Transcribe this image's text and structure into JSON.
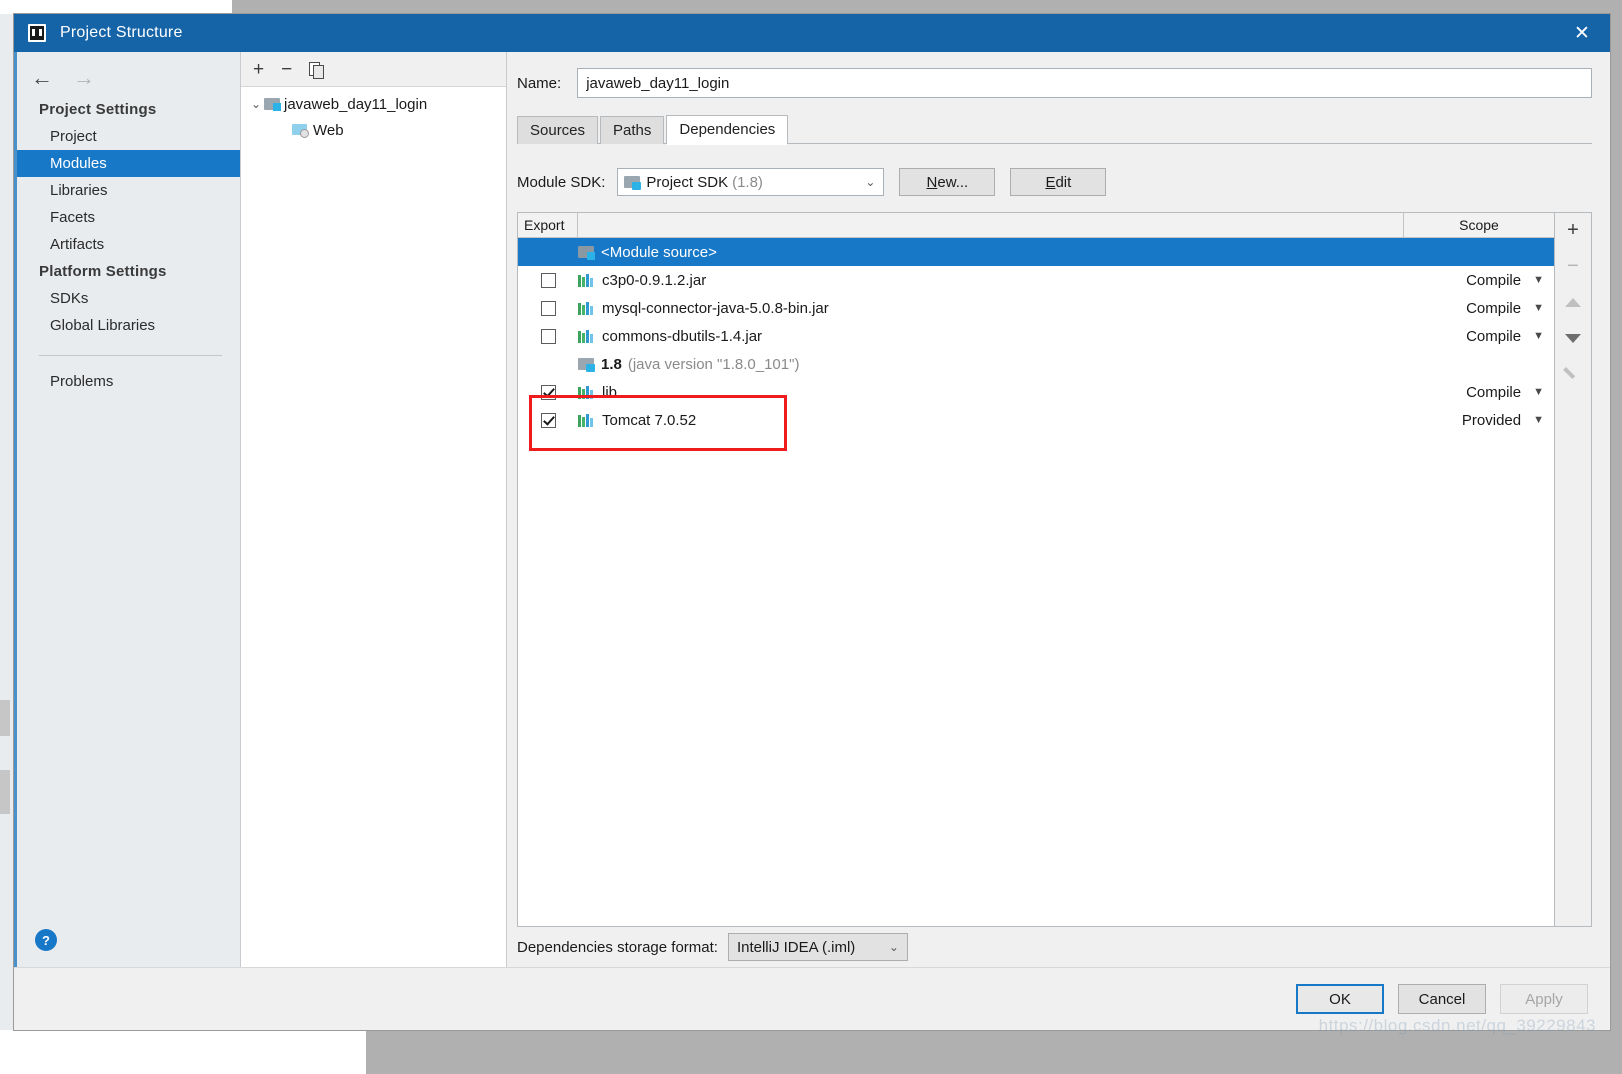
{
  "window": {
    "title": "Project Structure",
    "close_label": "✕",
    "app_icon": "intellij-idea-icon"
  },
  "sidebar": {
    "back_arrow": "←",
    "forward_arrow": "→",
    "groups": [
      {
        "label": "Project Settings",
        "items": [
          {
            "label": "Project",
            "selected": false
          },
          {
            "label": "Modules",
            "selected": true
          },
          {
            "label": "Libraries",
            "selected": false
          },
          {
            "label": "Facets",
            "selected": false
          },
          {
            "label": "Artifacts",
            "selected": false
          }
        ]
      },
      {
        "label": "Platform Settings",
        "items": [
          {
            "label": "SDKs",
            "selected": false
          },
          {
            "label": "Global Libraries",
            "selected": false
          }
        ]
      }
    ],
    "problems_label": "Problems",
    "help_label": "?"
  },
  "tree": {
    "toolbar": {
      "add": "+",
      "remove": "−",
      "copy": "copy-icon"
    },
    "nodes": [
      {
        "label": "javaweb_day11_login",
        "icon": "module-folder-icon",
        "expanded": true,
        "chevron": "⌄"
      },
      {
        "label": "Web",
        "icon": "web-facet-icon",
        "expanded": false
      }
    ]
  },
  "module": {
    "name_label": "Name:",
    "name_value": "javaweb_day11_login",
    "tabs": [
      {
        "label": "Sources",
        "active": false
      },
      {
        "label": "Paths",
        "active": false
      },
      {
        "label": "Dependencies",
        "active": true
      }
    ],
    "sdk_label": "Module SDK:",
    "sdk_value": "Project SDK",
    "sdk_version": "(1.8)",
    "new_button": "New...",
    "edit_button": "Edit",
    "storage_label": "Dependencies storage format:",
    "storage_value": "IntelliJ IDEA (.iml)"
  },
  "dependencies_table": {
    "columns": {
      "export": "Export",
      "scope": "Scope"
    },
    "rows": [
      {
        "name": "<Module source>",
        "icon": "module-source-icon",
        "checkbox": "none",
        "scope": "",
        "selected": true,
        "highlighted": false
      },
      {
        "name": "c3p0-0.9.1.2.jar",
        "icon": "library-icon",
        "checkbox": "unchecked",
        "scope": "Compile",
        "selected": false,
        "highlighted": false
      },
      {
        "name": "mysql-connector-java-5.0.8-bin.jar",
        "icon": "library-icon",
        "checkbox": "unchecked",
        "scope": "Compile",
        "selected": false,
        "highlighted": false
      },
      {
        "name": "commons-dbutils-1.4.jar",
        "icon": "library-icon",
        "checkbox": "unchecked",
        "scope": "Compile",
        "selected": false,
        "highlighted": false
      },
      {
        "name": "1.8",
        "name_suffix": "(java version \"1.8.0_101\")",
        "icon": "jdk-icon",
        "checkbox": "none",
        "scope": "",
        "selected": false,
        "highlighted": false
      },
      {
        "name": "lib",
        "icon": "library-icon",
        "checkbox": "checked",
        "scope": "Compile",
        "selected": false,
        "highlighted": false
      },
      {
        "name": "Tomcat 7.0.52",
        "icon": "library-icon",
        "checkbox": "checked",
        "scope": "Provided",
        "selected": false,
        "highlighted": true
      }
    ],
    "side_toolbar": {
      "add": "+",
      "remove": "−",
      "move_up": "move-up-icon",
      "move_down": "move-down-icon",
      "edit": "edit-pencil-icon"
    }
  },
  "footer": {
    "ok": "OK",
    "cancel": "Cancel",
    "apply": "Apply",
    "watermark": "https://blog.csdn.net/qq_39229843"
  },
  "colors": {
    "title_bar": "#1664a8",
    "selection": "#1878c8",
    "annotation": "#ee1c1c",
    "sidebar_bg": "#e9ecef"
  }
}
